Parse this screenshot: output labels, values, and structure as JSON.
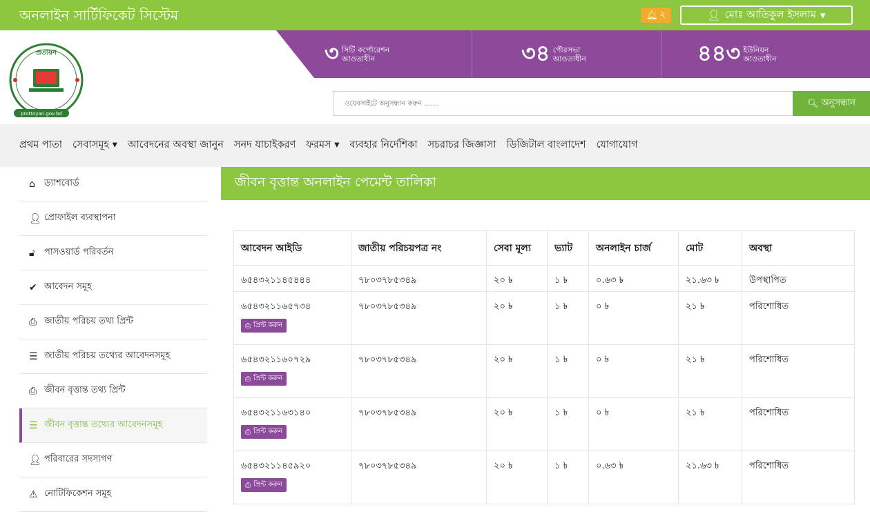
{
  "topbar": {
    "brand": "অনলাইন সার্টিফিকেট সিস্টেম",
    "notification_count": "২",
    "user_name": "মোঃ আতিকুল ইসলাম",
    "accent": "#8dc63f"
  },
  "header": {
    "logo_text": "প্রত্যয়ন",
    "logo_caption": "prottoyan.gov.bd",
    "stats": [
      {
        "num": "৩",
        "line1": "সিটি কর্পোরেশন",
        "line2": "আওতাধীন"
      },
      {
        "num": "৩৪",
        "line1": "পৌরসভা",
        "line2": "আওতাধীন"
      },
      {
        "num": "৪৪৩",
        "line1": "ইউনিয়ন",
        "line2": "আওতাধীন"
      }
    ],
    "search_placeholder": "ওয়েবসাইটে অনুসন্ধান করুন .......",
    "search_button": "অনুসন্ধান",
    "stats_color": "#8d4a9b"
  },
  "nav": {
    "items": [
      {
        "label": "প্রথম পাতা"
      },
      {
        "label": "সেবাসমূহ ▾"
      },
      {
        "label": "আবেদনের অবস্থা জানুন"
      },
      {
        "label": "সনদ যাচাইকরণ"
      },
      {
        "label": "ফরমস ▾"
      },
      {
        "label": "ব্যবহার নির্দেশিকা"
      },
      {
        "label": "সচরাচর জিজ্ঞাসা"
      },
      {
        "label": "ডিজিটাল বাংলাদেশ"
      },
      {
        "label": "যোগাযোগ"
      }
    ]
  },
  "sidebar": {
    "items": [
      {
        "label": "ড্যাশবোর্ড",
        "icon": "home-icon"
      },
      {
        "label": "প্রোফাইল ব্যবস্থাপনা",
        "icon": "user-icon"
      },
      {
        "label": "পাসওয়ার্ড পরিবর্তন",
        "icon": "unlock-icon"
      },
      {
        "label": "আবেদন সমূহ",
        "icon": "check-icon"
      },
      {
        "label": "জাতীয় পরিচয় তথ্য প্রিন্ট",
        "icon": "print-icon"
      },
      {
        "label": "জাতীয় পরিচয় তথ্যের আবেদনসমূহ",
        "icon": "list-icon"
      },
      {
        "label": "জীবন বৃত্তান্ত তথ্য প্রিন্ট",
        "icon": "print-icon"
      },
      {
        "label": "জীবন বৃত্তান্ত তথ্যের আবেদনসমূহ",
        "icon": "list-icon"
      },
      {
        "label": "পরিবারের সদস্যগণ",
        "icon": "user-icon"
      },
      {
        "label": "নোটিফিকেশন সমূহ",
        "icon": "warning-icon"
      }
    ]
  },
  "main": {
    "title": "জীবন বৃত্তান্ত অনলাইন পেমেন্ট তালিকা",
    "table": {
      "headers": [
        "আবেদন আইডি",
        "জাতীয় পরিচয়পত্র নং",
        "সেবা মূল্য",
        "ভ্যাট",
        "অনলাইন চার্জ",
        "মোট",
        "অবস্থা"
      ],
      "print_label": "প্রিন্ট করুন",
      "rows": [
        {
          "id": "৬৫৪৩২১১৪৫৪৪৪",
          "nid": "৭৮০৩৭৮৫৩৪৯",
          "fee": "২০ ৳",
          "vat": "১ ৳",
          "charge": "০.৬৩ ৳",
          "total": "২১.৬৩ ৳",
          "status": "উপস্থাপিত"
        },
        {
          "id": "৬৫৪৩২১১৬৫৭৩৪",
          "nid": "৭৮০৩৭৮৫৩৪৯",
          "fee": "২০ ৳",
          "vat": "১ ৳",
          "charge": "০ ৳",
          "total": "২১ ৳",
          "status": "পরিশোধিত"
        },
        {
          "id": "৬৫৪৩২১১৬০৭২৯",
          "nid": "৭৮০৩৭৮৫৩৪৯",
          "fee": "২০ ৳",
          "vat": "১ ৳",
          "charge": "০ ৳",
          "total": "২১ ৳",
          "status": "পরিশোধিত"
        },
        {
          "id": "৬৫৪৩২১১৬৩১৪০",
          "nid": "৭৮০৩৭৮৫৩৪৯",
          "fee": "২০ ৳",
          "vat": "১ ৳",
          "charge": "০ ৳",
          "total": "২১ ৳",
          "status": "পরিশোধিত"
        },
        {
          "id": "৬৫৪৩২১১৪৫৯২০",
          "nid": "৭৮০৩৭৮৫৩৪৯",
          "fee": "২০ ৳",
          "vat": "১ ৳",
          "charge": "০.৬৩ ৳",
          "total": "২১.৬৩ ৳",
          "status": "পরিশোধিত"
        }
      ]
    }
  }
}
